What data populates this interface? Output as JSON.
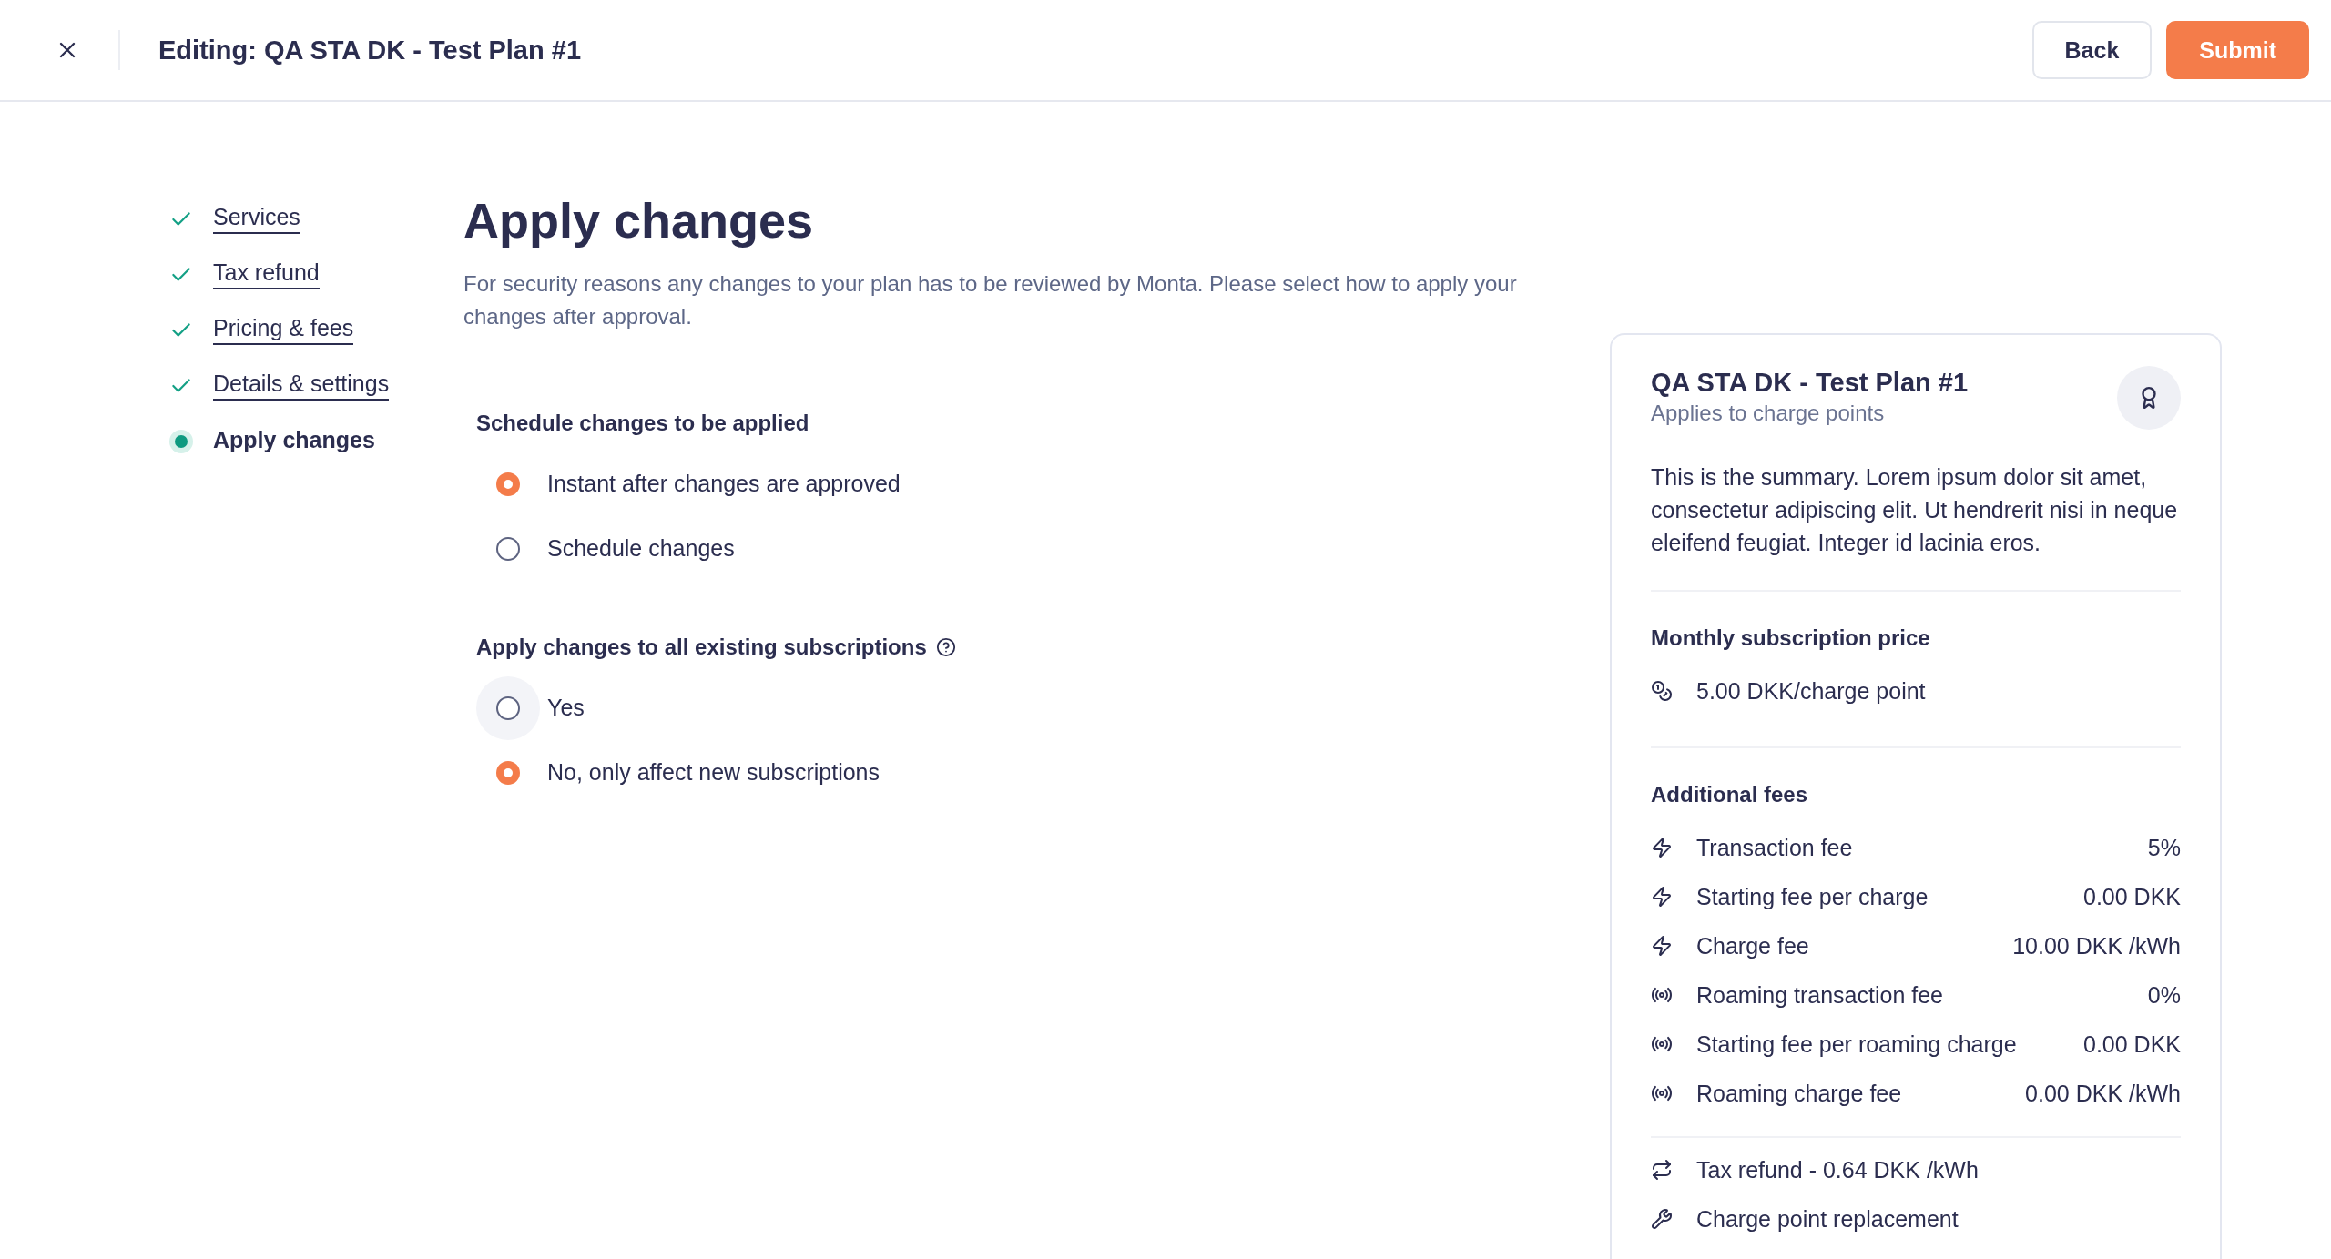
{
  "header": {
    "title": "Editing: QA STA DK - Test Plan #1",
    "buttons": [
      {
        "label": "Back",
        "kind": "secondary"
      },
      {
        "label": "Submit",
        "kind": "primary"
      }
    ]
  },
  "steps": [
    {
      "label": "Services",
      "kind": "done"
    },
    {
      "label": "Tax refund",
      "kind": "done"
    },
    {
      "label": "Pricing & fees",
      "kind": "done"
    },
    {
      "label": "Details & settings",
      "kind": "done"
    },
    {
      "label": "Apply changes",
      "kind": "current"
    }
  ],
  "main": {
    "heading": "Apply changes",
    "description": "For security reasons any changes to your plan has to be reviewed by Monta. Please select how to apply your changes after approval.",
    "groups": [
      {
        "title": "Schedule changes to be applied",
        "help": false,
        "options": [
          {
            "label": "Instant after changes are approved",
            "selected": true,
            "hovered": false
          },
          {
            "label": "Schedule changes",
            "selected": false,
            "hovered": false
          }
        ]
      },
      {
        "title": "Apply changes to all existing subscriptions",
        "help": true,
        "options": [
          {
            "label": "Yes",
            "selected": false,
            "hovered": true
          },
          {
            "label": "No, only affect new subscriptions",
            "selected": true,
            "hovered": false
          }
        ]
      }
    ]
  },
  "summary_card": {
    "title": "QA STA DK - Test Plan #1",
    "subtitle": "Applies to charge points",
    "summary": "This is the summary. Lorem ipsum dolor sit amet, consectetur adipiscing elit. Ut hendrerit nisi in neque eleifend feugiat. Integer id lacinia eros.",
    "monthly": {
      "title": "Monthly subscription price",
      "items": [
        {
          "kind": "coins",
          "label": "5.00 DKK/charge point"
        }
      ]
    },
    "fees": {
      "title": "Additional fees",
      "rows": [
        {
          "kind": "bolt",
          "label": "Transaction fee",
          "value": "5%"
        },
        {
          "kind": "bolt",
          "label": "Starting fee per charge",
          "value": "0.00 DKK"
        },
        {
          "kind": "bolt",
          "label": "Charge fee",
          "value": "10.00 DKK /kWh"
        },
        {
          "kind": "roaming",
          "label": "Roaming transaction fee",
          "value": "0%"
        },
        {
          "kind": "roaming",
          "label": "Starting fee per roaming charge",
          "value": "0.00 DKK"
        },
        {
          "kind": "roaming",
          "label": "Roaming charge fee",
          "value": "0.00 DKK /kWh"
        }
      ]
    },
    "extras": [
      {
        "kind": "refund",
        "label": "Tax refund - 0.64 DKK /kWh"
      },
      {
        "kind": "wrench",
        "label": "Charge point replacement"
      }
    ]
  }
}
